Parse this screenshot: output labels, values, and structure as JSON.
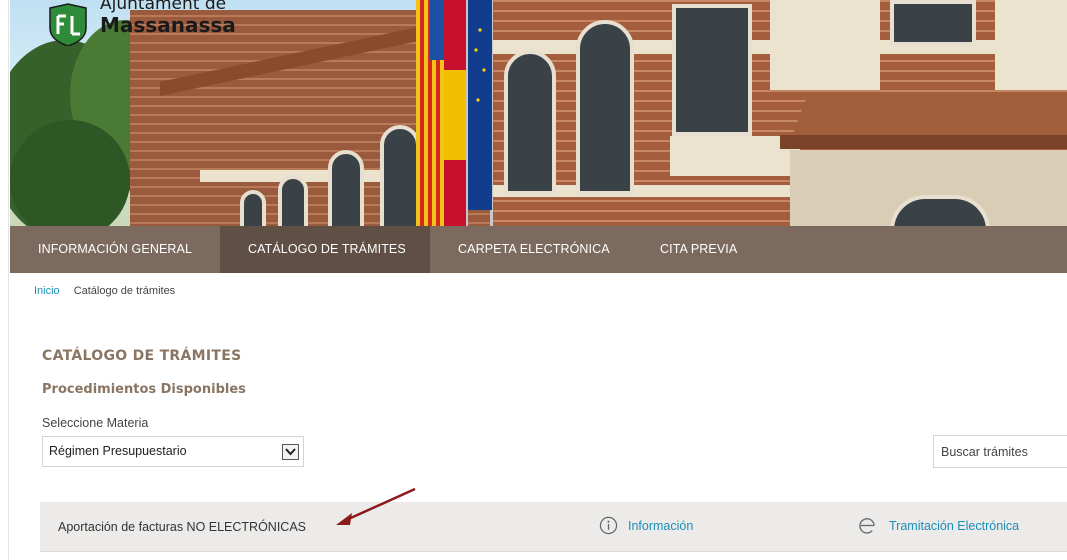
{
  "header": {
    "logo_line1": "Ajuntament de",
    "logo_line2": "Massanassa"
  },
  "nav": {
    "items": [
      {
        "label": "INFORMACIÓN GENERAL",
        "active": false
      },
      {
        "label": "CATÁLOGO DE TRÁMITES",
        "active": true
      },
      {
        "label": "CARPETA ELECTRÓNICA",
        "active": false
      },
      {
        "label": "CITA PREVIA",
        "active": false
      }
    ]
  },
  "breadcrumb": {
    "home": "Inicio",
    "current": "Catálogo de trámites"
  },
  "main": {
    "title": "CATÁLOGO DE TRÁMITES",
    "subtitle": "Procedimientos Disponibles",
    "select_label": "Seleccione Materia",
    "select_value": "Régimen Presupuestario",
    "search_placeholder": "Buscar trámites",
    "results": [
      {
        "title": "Aportación de facturas NO ELECTRÓNICAS",
        "info_label": "Información",
        "tramitacion_label": "Tramitación Electrónica"
      }
    ]
  },
  "colors": {
    "nav_bg": "#7b6a5d",
    "nav_active_bg": "#5f4f44",
    "heading": "#8a7563",
    "link": "#1b8fb7",
    "row_bg": "#ecebea",
    "annotation_arrow": "#8b1a1a"
  },
  "icons": {
    "logo": "municipal-shield-icon",
    "select_arrow": "chevron-down-icon",
    "info": "info-circle-icon",
    "tramitacion": "e-symbol-icon"
  }
}
